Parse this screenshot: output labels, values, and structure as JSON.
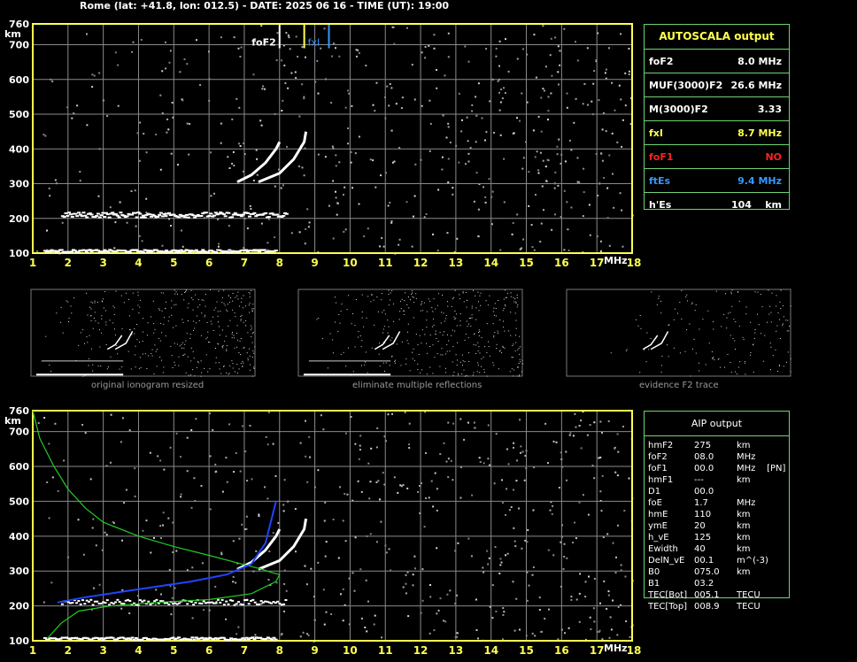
{
  "header": "Rome (lat: +41.8, lon: 012.5) - DATE: 2025 06 16 - TIME (UT): 19:00",
  "colors": {
    "grid": "#8a8a8a",
    "axis": "#ffff50",
    "table_border": "#6fd36f",
    "green": "#22cc22",
    "blue": "#2244ff",
    "yellow": "#ffff50",
    "red": "#ff2020",
    "cyan": "#3399ff"
  },
  "chart_data": [
    {
      "type": "scatter",
      "title": "",
      "xlabel": "MHz",
      "ylabel": "km",
      "xlim": [
        1,
        18
      ],
      "ylim": [
        100,
        760
      ],
      "x_ticks": [
        "1",
        "2",
        "3",
        "4",
        "5",
        "6",
        "7",
        "8",
        "9",
        "10",
        "11",
        "12",
        "13",
        "14",
        "15",
        "16",
        "17",
        "18"
      ],
      "y_ticks": [
        "100",
        "200",
        "300",
        "400",
        "500",
        "600",
        "700",
        "760"
      ],
      "markers": {
        "foF2": 8.0,
        "fxI": 8.7,
        "ftEs": 9.4,
        "foF2_label": "foF2",
        "fxI_label": "fxI"
      },
      "traces": [
        {
          "name": "Es",
          "x": [
            1.3,
            7.9
          ],
          "y": [
            105,
            112
          ]
        },
        {
          "name": "Es 2nd hop",
          "x": [
            1.8,
            8.2
          ],
          "y": [
            205,
            220
          ]
        },
        {
          "name": "F2 ordinary",
          "x": [
            6.8,
            7.2,
            7.6,
            7.9,
            8.0
          ],
          "y": [
            305,
            325,
            360,
            400,
            420
          ]
        },
        {
          "name": "F2 extraordinary",
          "x": [
            7.4,
            8.0,
            8.4,
            8.7,
            8.75
          ],
          "y": [
            305,
            330,
            370,
            420,
            450
          ]
        }
      ]
    },
    {
      "type": "line",
      "title": "",
      "xlabel": "MHz",
      "ylabel": "km",
      "xlim": [
        1,
        18
      ],
      "ylim": [
        100,
        760
      ],
      "x_ticks": [
        "1",
        "2",
        "3",
        "4",
        "5",
        "6",
        "7",
        "8",
        "9",
        "10",
        "11",
        "12",
        "13",
        "14",
        "15",
        "16",
        "17",
        "18"
      ],
      "y_ticks": [
        "100",
        "200",
        "300",
        "400",
        "500",
        "600",
        "700",
        "760"
      ],
      "series": [
        {
          "name": "profile",
          "x": [
            1.0,
            1.2,
            1.6,
            2.0,
            2.5,
            3.0,
            4.0,
            5.0,
            6.0,
            7.0,
            7.5,
            7.8,
            8.0
          ],
          "y": [
            760,
            680,
            600,
            535,
            480,
            440,
            400,
            370,
            345,
            318,
            305,
            295,
            290
          ]
        },
        {
          "name": "virtual height",
          "x": [
            1.7,
            2.5,
            3.5,
            4.5,
            5.5,
            6.5,
            7.2,
            7.6,
            7.9
          ],
          "y": [
            210,
            225,
            240,
            255,
            270,
            290,
            320,
            380,
            500
          ]
        }
      ]
    }
  ],
  "autoscala": {
    "title": "AUTOSCALA output",
    "rows": [
      {
        "label": "foF2",
        "value": "8.0 MHz",
        "color": "#ffffff"
      },
      {
        "label": "MUF(3000)F2",
        "value": "26.6 MHz",
        "color": "#ffffff"
      },
      {
        "label": "M(3000)F2",
        "value": "3.33",
        "color": "#ffffff"
      },
      {
        "label": "fxI",
        "value": "8.7 MHz",
        "color": "#ffff50"
      },
      {
        "label": "foF1",
        "value": "NO",
        "color": "#ff2020"
      },
      {
        "label": "ftEs",
        "value": "9.4 MHz",
        "color": "#3399ff"
      },
      {
        "label": "h'Es",
        "value": "104    km",
        "color": "#ffffff"
      }
    ]
  },
  "thumbnails": [
    {
      "caption": "original ionogram resized"
    },
    {
      "caption": "eliminate multiple reflections"
    },
    {
      "caption": "evidence F2 trace"
    }
  ],
  "aip": {
    "title": "AIP output",
    "rows": [
      {
        "label": "hmF2",
        "value": "275",
        "unit": "km"
      },
      {
        "label": "foF2",
        "value": "08.0",
        "unit": "MHz"
      },
      {
        "label": "foF1",
        "value": "00.0",
        "unit": "MHz    [PN]"
      },
      {
        "label": "hmF1",
        "value": "---",
        "unit": "km"
      },
      {
        "label": "D1",
        "value": "00.0",
        "unit": ""
      },
      {
        "label": "foE",
        "value": "1.7",
        "unit": "MHz"
      },
      {
        "label": "hmE",
        "value": "110",
        "unit": "km"
      },
      {
        "label": "ymE",
        "value": "20",
        "unit": "km"
      },
      {
        "label": "h_vE",
        "value": "125",
        "unit": "km"
      },
      {
        "label": "Ewidth",
        "value": "40",
        "unit": "km"
      },
      {
        "label": "DelN_vE",
        "value": "00.1",
        "unit": "m^(-3)"
      },
      {
        "label": "B0",
        "value": "075.0",
        "unit": "km"
      },
      {
        "label": "B1",
        "value": "03.2",
        "unit": ""
      },
      {
        "label": "TEC[Bot]",
        "value": "005.1",
        "unit": "TECU"
      },
      {
        "label": "TEC[Top]",
        "value": "008.9",
        "unit": "TECU"
      }
    ]
  }
}
